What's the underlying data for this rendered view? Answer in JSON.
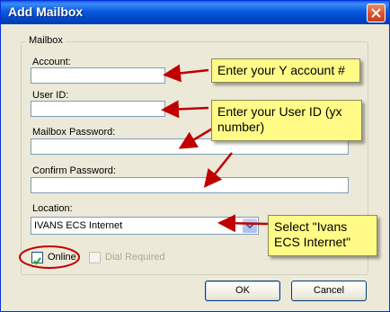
{
  "window": {
    "title": "Add Mailbox"
  },
  "group": {
    "label": "Mailbox"
  },
  "fields": {
    "account": {
      "label": "Account:",
      "value": ""
    },
    "user_id": {
      "label": "User ID:",
      "value": ""
    },
    "mailbox_password": {
      "label": "Mailbox Password:",
      "value": ""
    },
    "confirm_password": {
      "label": "Confirm Password:",
      "value": ""
    },
    "location": {
      "label": "Location:",
      "value": "IVANS ECS Internet"
    }
  },
  "checkboxes": {
    "online": {
      "label": "Online",
      "checked": true
    },
    "dial_required": {
      "label": "Dial Required",
      "checked": false,
      "disabled": true
    }
  },
  "buttons": {
    "ok": "OK",
    "cancel": "Cancel"
  },
  "callouts": {
    "account": "Enter your Y account #",
    "user_id": "Enter your User ID (yx number)",
    "location": "Select \"Ivans ECS Internet\""
  },
  "colors": {
    "titlebar": "#0a5adf",
    "callout": "#fffb86",
    "arrow": "#c00000",
    "highlight_circle": "#c00000"
  }
}
